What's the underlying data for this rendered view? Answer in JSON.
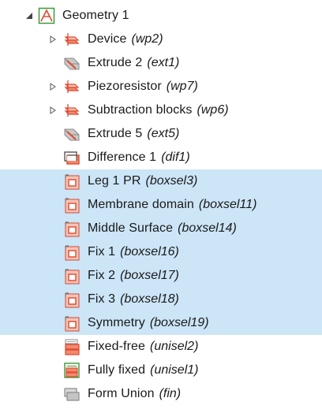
{
  "tree": {
    "root": {
      "label": "Geometry 1",
      "icon": "geometry-icon"
    },
    "items": [
      {
        "label": "Device",
        "tag": "(wp2)",
        "icon": "work-plane-icon",
        "expandable": true,
        "selected": false
      },
      {
        "label": "Extrude 2",
        "tag": "(ext1)",
        "icon": "extrude-icon",
        "expandable": false,
        "selected": false
      },
      {
        "label": "Piezoresistor",
        "tag": "(wp7)",
        "icon": "work-plane-icon",
        "expandable": true,
        "selected": false
      },
      {
        "label": "Subtraction blocks",
        "tag": "(wp6)",
        "icon": "work-plane-icon",
        "expandable": true,
        "selected": false
      },
      {
        "label": "Extrude 5",
        "tag": "(ext5)",
        "icon": "extrude-icon",
        "expandable": false,
        "selected": false
      },
      {
        "label": "Difference 1",
        "tag": "(dif1)",
        "icon": "difference-icon",
        "expandable": false,
        "selected": false
      },
      {
        "label": "Leg 1 PR",
        "tag": "(boxsel3)",
        "icon": "box-selection-icon",
        "expandable": false,
        "selected": true
      },
      {
        "label": "Membrane domain",
        "tag": "(boxsel11)",
        "icon": "box-selection-icon",
        "expandable": false,
        "selected": true
      },
      {
        "label": "Middle Surface",
        "tag": "(boxsel14)",
        "icon": "box-selection-icon",
        "expandable": false,
        "selected": true
      },
      {
        "label": "Fix 1",
        "tag": "(boxsel16)",
        "icon": "box-selection-icon",
        "expandable": false,
        "selected": true
      },
      {
        "label": "Fix 2",
        "tag": "(boxsel17)",
        "icon": "box-selection-icon",
        "expandable": false,
        "selected": true
      },
      {
        "label": "Fix 3",
        "tag": "(boxsel18)",
        "icon": "box-selection-icon",
        "expandable": false,
        "selected": true
      },
      {
        "label": "Symmetry",
        "tag": "(boxsel19)",
        "icon": "box-selection-icon",
        "expandable": false,
        "selected": true
      },
      {
        "label": "Fixed-free",
        "tag": "(unisel2)",
        "icon": "union-selection-icon",
        "expandable": false,
        "selected": false
      },
      {
        "label": "Fully fixed",
        "tag": "(unisel1)",
        "icon": "union-selection-green-icon",
        "expandable": false,
        "selected": false
      },
      {
        "label": "Form Union",
        "tag": "(fin)",
        "icon": "form-union-icon",
        "expandable": false,
        "selected": false
      }
    ]
  },
  "colors": {
    "selection": "#cce5f7",
    "accent_red": "#e0482c",
    "arrow": "#555555"
  }
}
